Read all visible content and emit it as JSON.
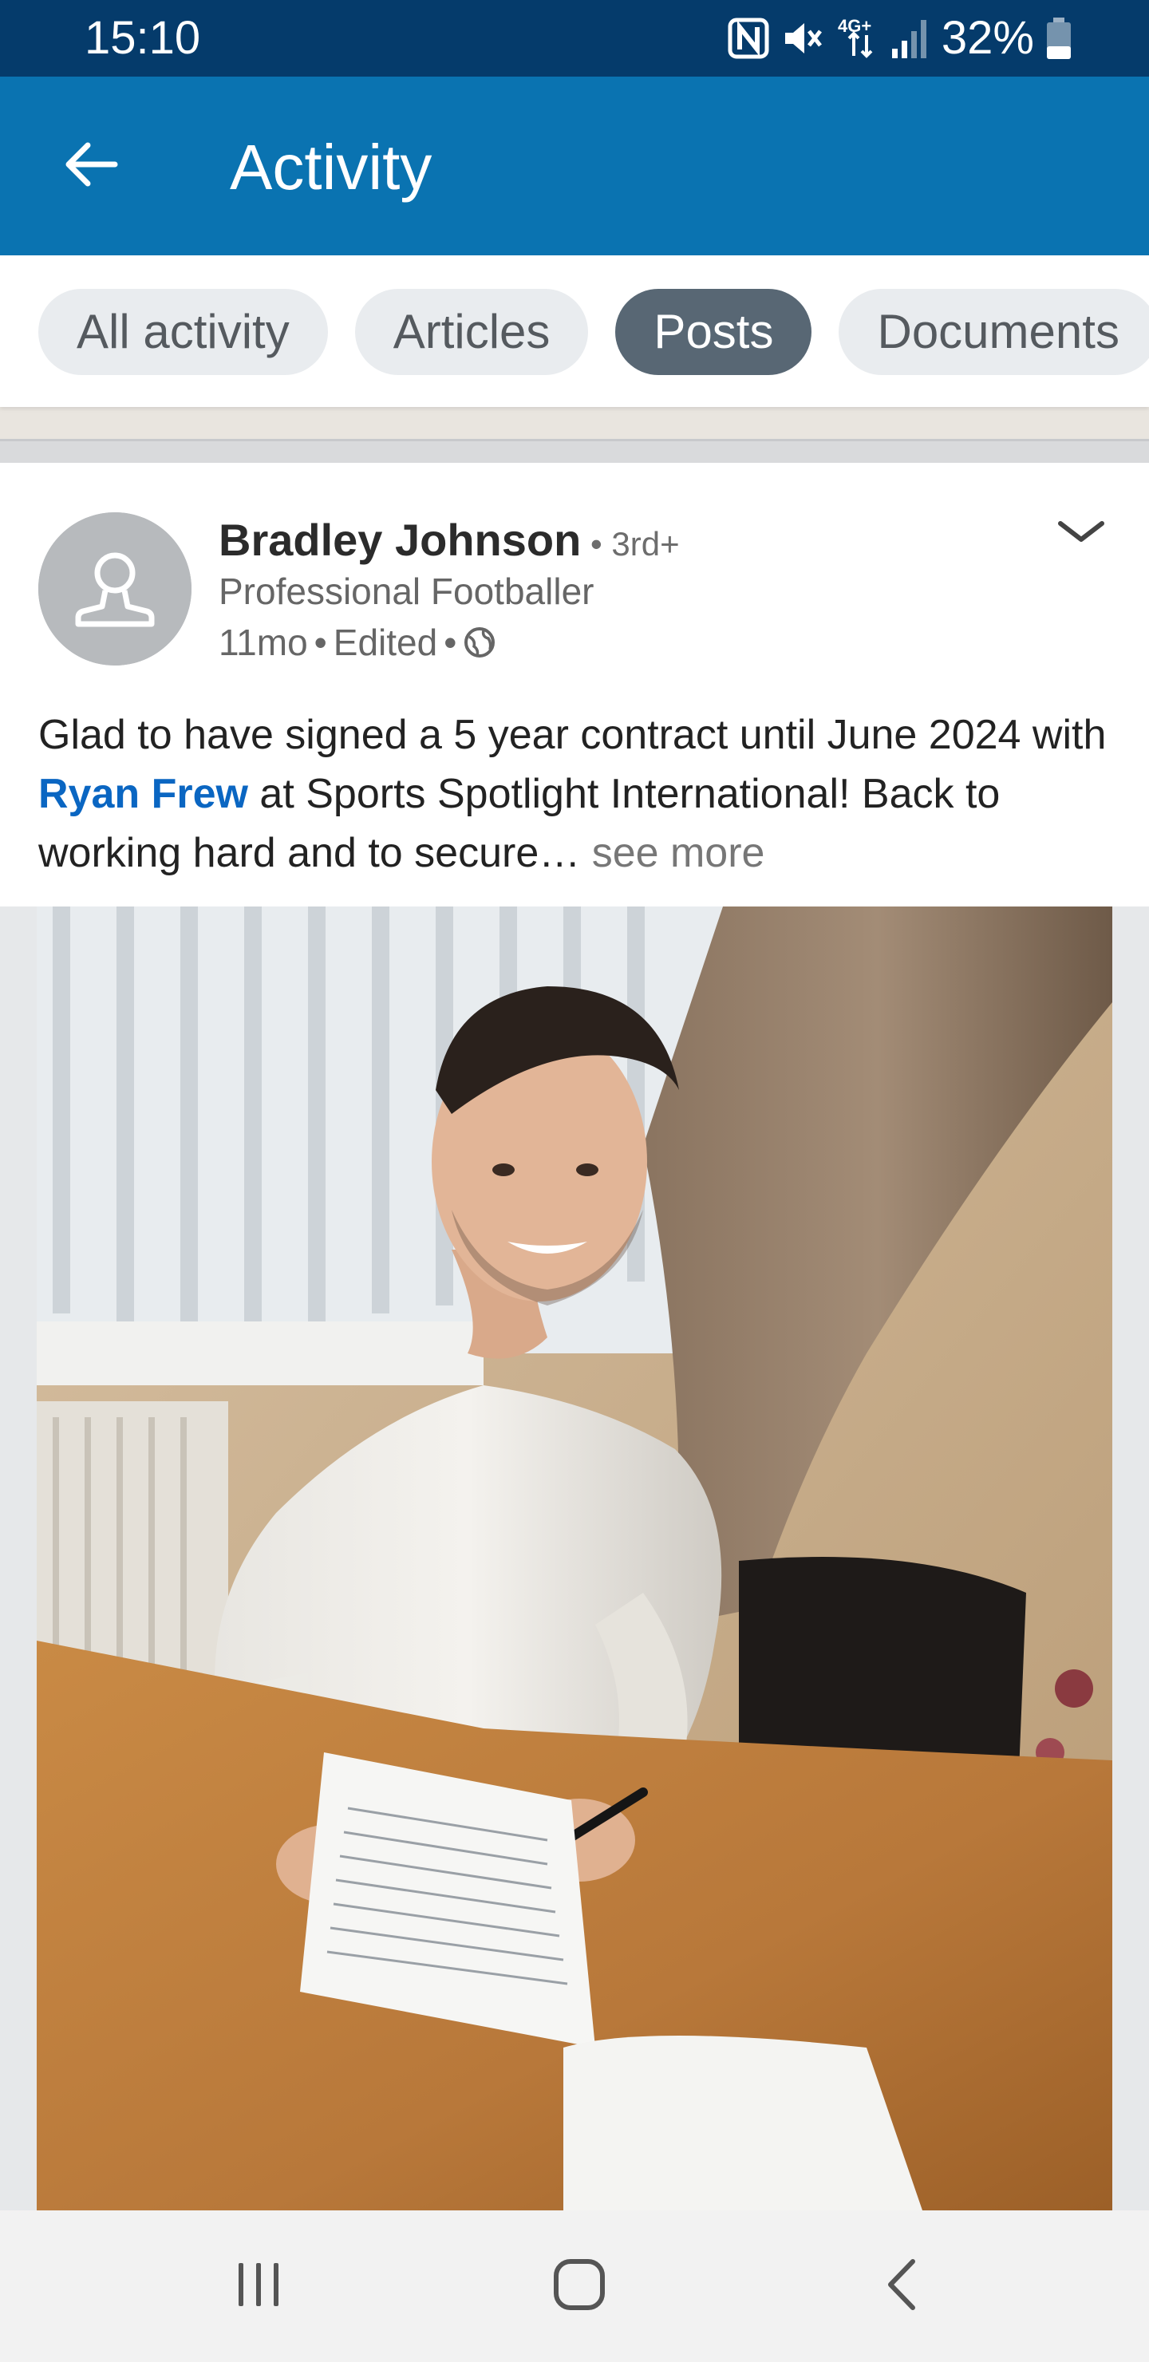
{
  "status_bar": {
    "time": "15:10",
    "network": "4G+",
    "battery": "32%",
    "icons": [
      "nfc-icon",
      "mute-icon",
      "network-4g-icon",
      "signal-icon",
      "battery-icon"
    ]
  },
  "app_bar": {
    "title": "Activity",
    "back_icon": "arrow-left-icon",
    "background": "#0a73b1"
  },
  "filters": {
    "chips": [
      {
        "label": "All activity",
        "active": false
      },
      {
        "label": "Articles",
        "active": false
      },
      {
        "label": "Posts",
        "active": true
      },
      {
        "label": "Documents",
        "active": false
      }
    ]
  },
  "post": {
    "author": {
      "name": "Bradley Johnson",
      "degree": " • 3rd+",
      "headline": "Professional Footballer",
      "avatar_icon": "default-person-avatar"
    },
    "meta": {
      "age": "11mo",
      "edited": "Edited",
      "visibility_icon": "globe-icon"
    },
    "text_before": "Glad to have signed a 5 year contract until June 2024 with ",
    "mention": "Ryan Frew",
    "text_after": " at Sports Spotlight International! Back to working hard and to secure…",
    "see_more": " see more",
    "image": {
      "description_icon": "post-photo"
    }
  },
  "nav_bar": {
    "icons": [
      "recent-apps-icon",
      "home-icon",
      "back-icon"
    ]
  },
  "colors": {
    "status_bar": "#053b6b",
    "app_bar": "#0a73b1",
    "chip_active": "#586774",
    "chip_inactive": "#e9ecef",
    "mention": "#0a66c2"
  }
}
